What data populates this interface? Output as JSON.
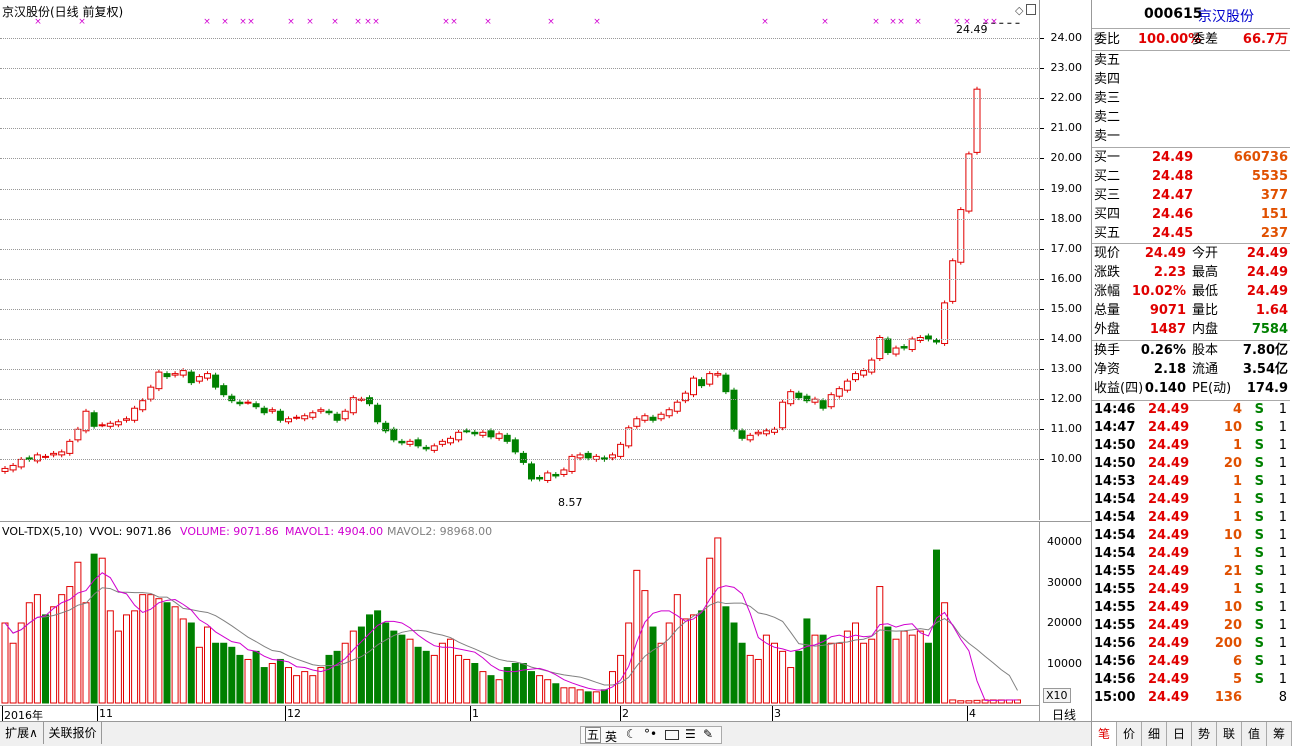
{
  "chart_header": {
    "title": "京汉股份(日线 前复权)"
  },
  "price_axis": {
    "ticks": [
      "24.00",
      "23.00",
      "22.00",
      "21.00",
      "20.00",
      "19.00",
      "18.00",
      "17.00",
      "16.00",
      "15.00",
      "14.00",
      "13.00",
      "12.00",
      "11.00",
      "10.00"
    ]
  },
  "annotations": {
    "high_label": "24.49",
    "low_label": "8.57"
  },
  "volume_header": {
    "indicator": "VOL-TDX(5,10)",
    "vvol": "VVOL: 9071.86",
    "volume": "VOLUME: 9071.86",
    "mavol1": "MAVOL1: 4904.00",
    "mavol2": "MAVOL2: 98968.00"
  },
  "volume_axis": {
    "ticks": [
      "40000",
      "30000",
      "20000",
      "10000"
    ],
    "unit": "X10"
  },
  "date_axis": {
    "labels": [
      "2016年",
      "11",
      "12",
      "1",
      "2",
      "3",
      "4"
    ]
  },
  "period_label": "日线",
  "bottom_tabs": {
    "expand": "扩展∧",
    "related": "关联报价"
  },
  "toolbar_icons": [
    "五",
    "英"
  ],
  "stock": {
    "code": "000615",
    "name": "京汉股份"
  },
  "order_book": {
    "weibi_label": "委比",
    "weibi": "100.00%",
    "weicha_label": "委差",
    "weicha": "66.7万",
    "sells": [
      {
        "label": "卖五"
      },
      {
        "label": "卖四"
      },
      {
        "label": "卖三"
      },
      {
        "label": "卖二"
      },
      {
        "label": "卖一"
      }
    ],
    "buys": [
      {
        "label": "买一",
        "price": "24.49",
        "vol": "660736"
      },
      {
        "label": "买二",
        "price": "24.48",
        "vol": "5535"
      },
      {
        "label": "买三",
        "price": "24.47",
        "vol": "377"
      },
      {
        "label": "买四",
        "price": "24.46",
        "vol": "151"
      },
      {
        "label": "买五",
        "price": "24.45",
        "vol": "237"
      }
    ]
  },
  "quote": [
    {
      "l1": "现价",
      "v1": "24.49",
      "l2": "今开",
      "v2": "24.49"
    },
    {
      "l1": "涨跌",
      "v1": "2.23",
      "l2": "最高",
      "v2": "24.49"
    },
    {
      "l1": "涨幅",
      "v1": "10.02%",
      "l2": "最低",
      "v2": "24.49"
    },
    {
      "l1": "总量",
      "v1": "9071",
      "l2": "量比",
      "v2": "1.64"
    },
    {
      "l1": "外盘",
      "v1": "1487",
      "l2": "内盘",
      "v2": "7584"
    }
  ],
  "fundamentals": [
    {
      "l1": "换手",
      "v1": "0.26%",
      "l2": "股本",
      "v2": "7.80亿"
    },
    {
      "l1": "净资",
      "v1": "2.18",
      "l2": "流通",
      "v2": "3.54亿"
    },
    {
      "l1": "收益(四)",
      "v1": "0.140",
      "l2": "PE(动)",
      "v2": "174.9"
    }
  ],
  "ticks": [
    {
      "t": "14:46",
      "p": "24.49",
      "v": "4",
      "s": "S",
      "n": "1"
    },
    {
      "t": "14:47",
      "p": "24.49",
      "v": "10",
      "s": "S",
      "n": "1"
    },
    {
      "t": "14:50",
      "p": "24.49",
      "v": "1",
      "s": "S",
      "n": "1"
    },
    {
      "t": "14:50",
      "p": "24.49",
      "v": "20",
      "s": "S",
      "n": "1"
    },
    {
      "t": "14:53",
      "p": "24.49",
      "v": "1",
      "s": "S",
      "n": "1"
    },
    {
      "t": "14:54",
      "p": "24.49",
      "v": "1",
      "s": "S",
      "n": "1"
    },
    {
      "t": "14:54",
      "p": "24.49",
      "v": "1",
      "s": "S",
      "n": "1"
    },
    {
      "t": "14:54",
      "p": "24.49",
      "v": "10",
      "s": "S",
      "n": "1"
    },
    {
      "t": "14:54",
      "p": "24.49",
      "v": "1",
      "s": "S",
      "n": "1"
    },
    {
      "t": "14:55",
      "p": "24.49",
      "v": "21",
      "s": "S",
      "n": "1"
    },
    {
      "t": "14:55",
      "p": "24.49",
      "v": "1",
      "s": "S",
      "n": "1"
    },
    {
      "t": "14:55",
      "p": "24.49",
      "v": "10",
      "s": "S",
      "n": "1"
    },
    {
      "t": "14:55",
      "p": "24.49",
      "v": "20",
      "s": "S",
      "n": "1"
    },
    {
      "t": "14:56",
      "p": "24.49",
      "v": "200",
      "s": "S",
      "n": "1"
    },
    {
      "t": "14:56",
      "p": "24.49",
      "v": "6",
      "s": "S",
      "n": "1"
    },
    {
      "t": "14:56",
      "p": "24.49",
      "v": "5",
      "s": "S",
      "n": "1"
    },
    {
      "t": "15:00",
      "p": "24.49",
      "v": "136",
      "s": "",
      "n": "8"
    }
  ],
  "right_tabs": [
    "笔",
    "价",
    "细",
    "日",
    "势",
    "联",
    "值",
    "筹"
  ],
  "colors": {
    "up": "#e00000",
    "down": "#008000",
    "ma1": "#d000d0",
    "ma2": "#808080",
    "marker": "#d000d0"
  },
  "chart_data": {
    "type": "candlestick",
    "price_range": [
      9.3,
      24.7
    ],
    "volume_range": [
      0,
      44000
    ],
    "closes": [
      9.7,
      9.8,
      10.0,
      10.0,
      10.15,
      10.1,
      10.2,
      10.25,
      10.6,
      11.0,
      11.6,
      11.1,
      11.15,
      11.2,
      11.25,
      11.35,
      11.7,
      11.95,
      12.4,
      12.9,
      12.75,
      12.85,
      12.95,
      12.55,
      12.75,
      12.85,
      12.4,
      12.15,
      11.95,
      11.85,
      11.9,
      11.75,
      11.55,
      11.65,
      11.3,
      11.35,
      11.4,
      11.45,
      11.55,
      11.65,
      11.55,
      11.3,
      11.6,
      12.05,
      12.0,
      11.85,
      11.25,
      10.95,
      10.65,
      10.55,
      10.6,
      10.45,
      10.35,
      10.45,
      10.6,
      10.7,
      10.9,
      10.95,
      10.85,
      10.9,
      10.75,
      10.85,
      10.6,
      10.25,
      9.9,
      9.35,
      9.35,
      9.55,
      9.45,
      9.65,
      10.1,
      10.15,
      10.05,
      10.1,
      10.0,
      10.15,
      10.5,
      11.05,
      11.35,
      11.45,
      11.3,
      11.5,
      11.65,
      11.9,
      12.2,
      12.7,
      12.45,
      12.85,
      12.85,
      12.25,
      11.0,
      10.7,
      10.8,
      10.9,
      10.95,
      11.0,
      11.9,
      12.25,
      12.05,
      11.95,
      12.0,
      11.7,
      12.15,
      12.35,
      12.6,
      12.85,
      12.95,
      13.3,
      14.05,
      13.55,
      13.7,
      13.7,
      14.0,
      14.05,
      14.0,
      13.9,
      15.2,
      16.6,
      18.3,
      20.15,
      22.3,
      24.49,
      24.49,
      24.49,
      24.49,
      24.49
    ],
    "volumes": [
      20000,
      15000,
      20000,
      25000,
      27000,
      22000,
      24000,
      27000,
      29000,
      35000,
      25000,
      37000,
      36000,
      23000,
      18000,
      22000,
      23000,
      27000,
      27000,
      26000,
      25000,
      24000,
      21000,
      20000,
      14000,
      19000,
      15000,
      15000,
      14000,
      12000,
      11000,
      13000,
      9000,
      10000,
      11000,
      9000,
      7000,
      8000,
      7000,
      9000,
      12000,
      13000,
      15000,
      18000,
      19000,
      22000,
      23000,
      20000,
      18000,
      17000,
      16000,
      14000,
      13000,
      12000,
      15000,
      16000,
      12000,
      11000,
      10000,
      8000,
      7000,
      6000,
      9000,
      10000,
      10000,
      8000,
      7000,
      6000,
      5000,
      4000,
      4000,
      3500,
      3000,
      3000,
      3500,
      8000,
      12000,
      20000,
      33000,
      28000,
      19000,
      15000,
      20000,
      27000,
      21000,
      22000,
      23000,
      36000,
      41000,
      24000,
      20000,
      15000,
      12000,
      11000,
      17000,
      15000,
      13000,
      9000,
      13000,
      21000,
      17000,
      17000,
      15000,
      15000,
      18000,
      20000,
      15000,
      16000,
      29000,
      19000,
      16000,
      18000,
      17000,
      18000,
      15000,
      38000,
      25000,
      1000,
      800,
      800,
      900,
      1000,
      1000,
      1000,
      1000,
      1000
    ]
  }
}
